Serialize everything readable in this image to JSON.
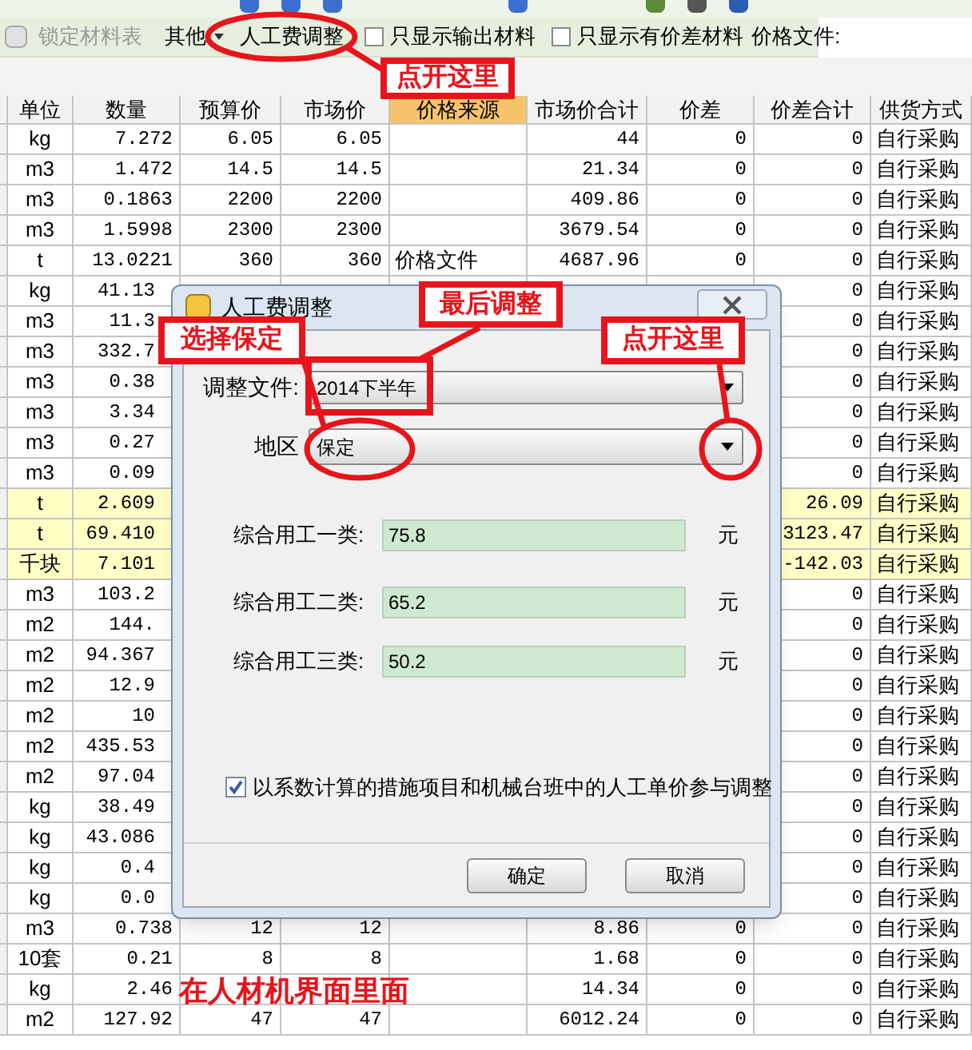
{
  "toolbar": {
    "items": [
      {
        "kind": "button",
        "label": "锁定材料表",
        "disabled": true
      },
      {
        "kind": "menu",
        "label": "其他",
        "disabled": false
      },
      {
        "kind": "button",
        "label": "人工费调整",
        "disabled": false
      },
      {
        "kind": "checkbox",
        "label": "只显示输出材料",
        "checked": false
      },
      {
        "kind": "checkbox",
        "label": "只显示有价差材料",
        "checked": false
      },
      {
        "kind": "label",
        "label": "价格文件:"
      }
    ]
  },
  "table": {
    "columns": [
      {
        "label": "单位",
        "selected": false
      },
      {
        "label": "数量",
        "selected": false
      },
      {
        "label": "预算价",
        "selected": false
      },
      {
        "label": "市场价",
        "selected": false
      },
      {
        "label": "价格来源",
        "selected": true
      },
      {
        "label": "市场价合计",
        "selected": false
      },
      {
        "label": "价差",
        "selected": false
      },
      {
        "label": "价差合计",
        "selected": false
      },
      {
        "label": "供货方式",
        "selected": false
      }
    ],
    "rows": [
      {
        "highlighted": false,
        "unit": "kg",
        "quantity": "7.272",
        "budget_price": "6.05",
        "market_price": "6.05",
        "market_total": "44",
        "price_diff": "0",
        "diff_total": "0",
        "supply": "自行采购"
      },
      {
        "highlighted": false,
        "unit": "m3",
        "quantity": "1.472",
        "budget_price": "14.5",
        "market_price": "14.5",
        "market_total": "21.34",
        "price_diff": "0",
        "diff_total": "0",
        "supply": "自行采购"
      },
      {
        "highlighted": false,
        "unit": "m3",
        "quantity": "0.1863",
        "budget_price": "2200",
        "market_price": "2200",
        "market_total": "409.86",
        "price_diff": "0",
        "diff_total": "0",
        "supply": "自行采购"
      },
      {
        "highlighted": false,
        "unit": "m3",
        "quantity": "1.5998",
        "budget_price": "2300",
        "market_price": "2300",
        "market_total": "3679.54",
        "price_diff": "0",
        "diff_total": "0",
        "supply": "自行采购"
      },
      {
        "highlighted": false,
        "unit": "t",
        "quantity": "13.0221",
        "budget_price": "360",
        "market_price": "360",
        "price_source": "价格文件",
        "market_total": "4687.96",
        "price_diff": "0",
        "diff_total": "0",
        "supply": "自行采购"
      },
      {
        "highlighted": false,
        "unit": "kg",
        "quantity": "41.13",
        "diff_total": "0",
        "supply": "自行采购"
      },
      {
        "highlighted": false,
        "unit": "m3",
        "quantity": "11.3",
        "diff_total": "0",
        "supply": "自行采购"
      },
      {
        "highlighted": false,
        "unit": "m3",
        "quantity": "332.7",
        "diff_total": "0",
        "supply": "自行采购"
      },
      {
        "highlighted": false,
        "unit": "m3",
        "quantity": "0.38",
        "diff_total": "0",
        "supply": "自行采购"
      },
      {
        "highlighted": false,
        "unit": "m3",
        "quantity": "3.34",
        "diff_total": "0",
        "supply": "自行采购"
      },
      {
        "highlighted": false,
        "unit": "m3",
        "quantity": "0.27",
        "diff_total": "0",
        "supply": "自行采购"
      },
      {
        "highlighted": false,
        "unit": "m3",
        "quantity": "0.09",
        "diff_total": "0",
        "supply": "自行采购"
      },
      {
        "highlighted": true,
        "unit": "t",
        "quantity": "2.609",
        "diff_total": "26.09",
        "supply": "自行采购"
      },
      {
        "highlighted": true,
        "unit": "t",
        "quantity": "69.410",
        "diff_total": "3123.47",
        "supply": "自行采购"
      },
      {
        "highlighted": true,
        "unit": "千块",
        "quantity": "7.101",
        "diff_total": "-142.03",
        "supply": "自行采购"
      },
      {
        "highlighted": false,
        "unit": "m3",
        "quantity": "103.2",
        "diff_total": "0",
        "supply": "自行采购"
      },
      {
        "highlighted": false,
        "unit": "m2",
        "quantity": "144.",
        "diff_total": "0",
        "supply": "自行采购"
      },
      {
        "highlighted": false,
        "unit": "m2",
        "quantity": "94.367",
        "diff_total": "0",
        "supply": "自行采购"
      },
      {
        "highlighted": false,
        "unit": "m2",
        "quantity": "12.9",
        "diff_total": "0",
        "supply": "自行采购"
      },
      {
        "highlighted": false,
        "unit": "m2",
        "quantity": "10",
        "diff_total": "0",
        "supply": "自行采购"
      },
      {
        "highlighted": false,
        "unit": "m2",
        "quantity": "435.53",
        "diff_total": "0",
        "supply": "自行采购"
      },
      {
        "highlighted": false,
        "unit": "m2",
        "quantity": "97.04",
        "diff_total": "0",
        "supply": "自行采购"
      },
      {
        "highlighted": false,
        "unit": "kg",
        "quantity": "38.49",
        "diff_total": "0",
        "supply": "自行采购"
      },
      {
        "highlighted": false,
        "unit": "kg",
        "quantity": "43.086",
        "diff_total": "0",
        "supply": "自行采购"
      },
      {
        "highlighted": false,
        "unit": "kg",
        "quantity": "0.4",
        "diff_total": "0",
        "supply": "自行采购"
      },
      {
        "highlighted": false,
        "unit": "kg",
        "quantity": "0.0",
        "diff_total": "0",
        "supply": "自行采购"
      },
      {
        "highlighted": false,
        "unit": "m3",
        "quantity": "0.738",
        "budget_price": "12",
        "market_price": "12",
        "market_total": "8.86",
        "price_diff": "0",
        "diff_total": "0",
        "supply": "自行采购"
      },
      {
        "highlighted": false,
        "unit": "10套",
        "quantity": "0.21",
        "budget_price": "8",
        "market_price": "8",
        "market_total": "1.68",
        "price_diff": "0",
        "diff_total": "0",
        "supply": "自行采购"
      },
      {
        "highlighted": false,
        "unit": "kg",
        "quantity": "2.46",
        "market_total": "14.34",
        "price_diff": "0",
        "diff_total": "0",
        "supply": "自行采购"
      },
      {
        "highlighted": false,
        "unit": "m2",
        "quantity": "127.92",
        "budget_price": "47",
        "market_price": "47",
        "market_total": "6012.24",
        "price_diff": "0",
        "diff_total": "0",
        "supply": "自行采购"
      }
    ]
  },
  "dialog": {
    "title": "人工费调整",
    "selects": [
      {
        "label": "调整文件:",
        "value": "2014下半年"
      },
      {
        "label": "地区",
        "value": "保定"
      }
    ],
    "rates": [
      {
        "label": "综合用工一类:",
        "value": "75.8",
        "unit": "元"
      },
      {
        "label": "综合用工二类:",
        "value": "65.2",
        "unit": "元"
      },
      {
        "label": "综合用工三类:",
        "value": "50.2",
        "unit": "元"
      }
    ],
    "option": {
      "label": "以系数计算的措施项目和机械台班中的人工单价参与调整",
      "checked": true
    },
    "buttons": [
      "确定",
      "取消"
    ]
  },
  "annotations": [
    {
      "kind": "boxed",
      "text": "点开这里"
    },
    {
      "kind": "boxed",
      "text": "最后调整"
    },
    {
      "kind": "boxed",
      "text": "选择保定"
    },
    {
      "kind": "boxed",
      "text": "点开这里"
    },
    {
      "kind": "plain",
      "text": "在人材机界面里面"
    }
  ]
}
